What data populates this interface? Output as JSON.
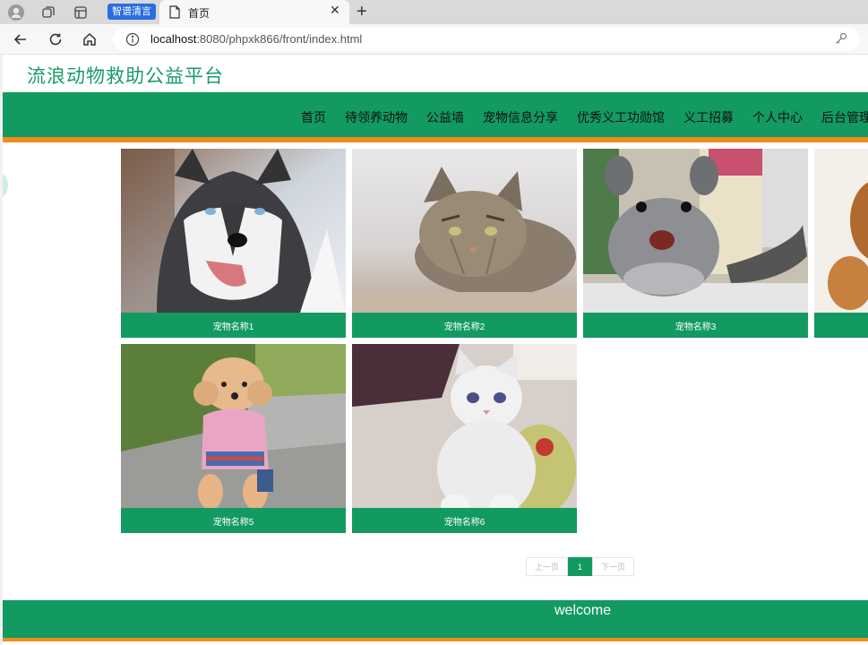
{
  "browser": {
    "extension_badge": "智谱清言",
    "tab_title": "首页",
    "url_host": "localhost",
    "url_rest": ":8080/phpxk866/front/index.html"
  },
  "site": {
    "title": "流浪动物救助公益平台"
  },
  "nav": {
    "items": [
      "首页",
      "待领养动物",
      "公益墙",
      "宠物信息分享",
      "优秀义工功勋馆",
      "义工招募",
      "个人中心",
      "后台管理"
    ]
  },
  "pets": [
    {
      "name": "宠物名称1",
      "image": "husky-dog-photo"
    },
    {
      "name": "宠物名称2",
      "image": "tabby-cat-photo"
    },
    {
      "name": "宠物名称3",
      "image": "chinchilla-photo"
    },
    {
      "name": "",
      "image": "partial-pet-photo"
    },
    {
      "name": "宠物名称5",
      "image": "poodle-dog-photo"
    },
    {
      "name": "宠物名称6",
      "image": "white-kitten-photo"
    }
  ],
  "pagination": {
    "prev": "上一页",
    "current": "1",
    "next": "下一页"
  },
  "footer": {
    "text": "welcome"
  },
  "colors": {
    "brand_green": "#129a61",
    "accent_orange": "#f08c1c",
    "title_green": "#1a9a68"
  }
}
